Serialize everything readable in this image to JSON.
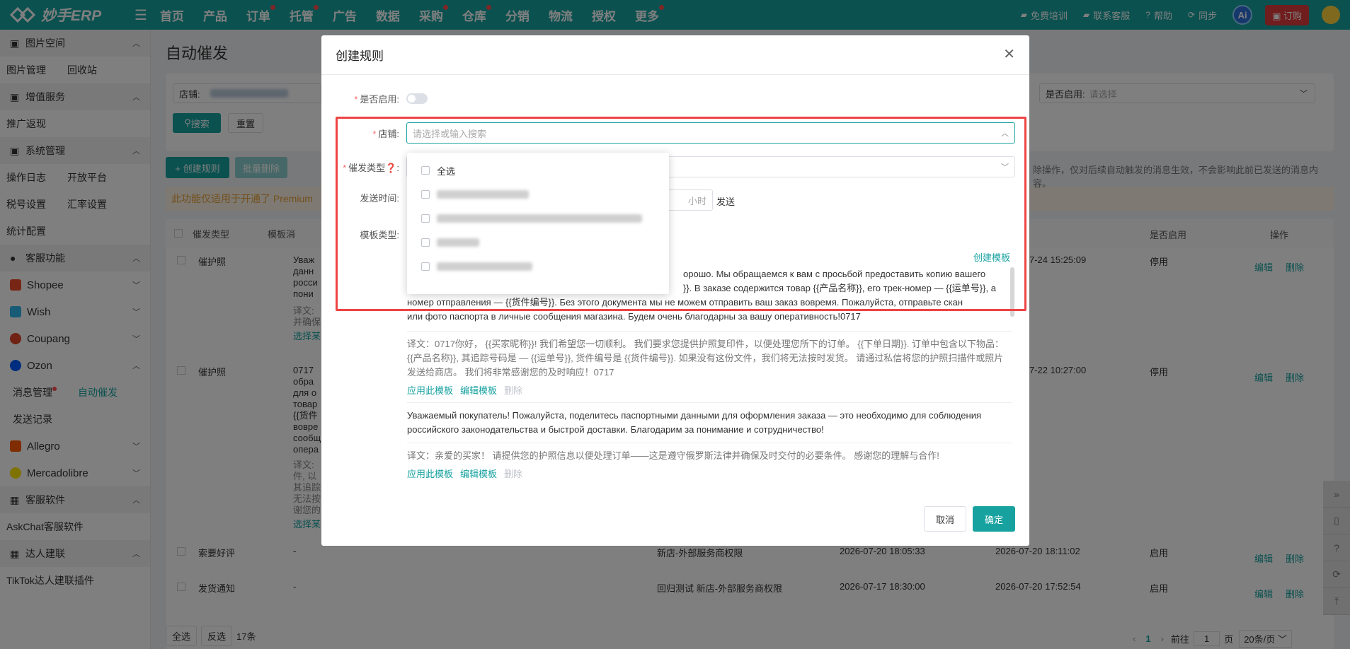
{
  "app": {
    "title": "妙手ERP"
  },
  "nav": {
    "items": [
      "首页",
      "产品",
      "订单",
      "托管",
      "广告",
      "数据",
      "采购",
      "仓库",
      "分销",
      "物流",
      "授权",
      "更多"
    ]
  },
  "top_right": {
    "training": "免费培训",
    "support": "联系客服",
    "help": "帮助",
    "sync": "同步",
    "ai": "Ai",
    "order": "订购"
  },
  "sidebar": {
    "g1": "图片空间",
    "g1_items": [
      "图片管理",
      "回收站"
    ],
    "g2": "增值服务",
    "g2_items": [
      "推广返现"
    ],
    "g3": "系统管理",
    "g3_items": [
      "操作日志",
      "开放平台",
      "税号设置",
      "汇率设置",
      "统计配置"
    ],
    "g4": "客服功能",
    "platforms": [
      "Shopee",
      "Wish",
      "Coupang",
      "Ozon"
    ],
    "ozon_sub": [
      "消息管理",
      "自动催发",
      "发送记录"
    ],
    "platforms2": [
      "Allegro",
      "Mercadolibre"
    ],
    "g5": "客服软件",
    "g5_items": [
      "AskChat客服软件"
    ],
    "g6": "达人建联",
    "g6_items": [
      "TikTok达人建联插件"
    ]
  },
  "page": {
    "title": "自动催发",
    "store_label": "店铺:",
    "enabled_label": "是否启用:",
    "enabled_placeholder": "请选择",
    "search": "搜索",
    "reset": "重置",
    "create": "+ 创建规则",
    "batch_delete": "批量删除",
    "notice": "此功能仅适用于开通了 Premium",
    "right_notice": "除操作，仅对后续自动触发的消息生效，不会影响此前已发送的消息内容。",
    "col_type": "催发类型",
    "col_tpl": "模板消",
    "col_enabled": "是否启用",
    "col_ops": "操作"
  },
  "rows": [
    {
      "type": "催护照",
      "time": "7-24 15:25:09",
      "enabled": "停用",
      "edit": "编辑",
      "del": "删除"
    },
    {
      "type": "催护照",
      "time": "7-22 10:27:00",
      "enabled": "停用",
      "edit": "编辑",
      "del": "删除"
    },
    {
      "type": "索要好评",
      "tpl": "-",
      "shop": "新店-外部服务商权限",
      "created": "2026-07-20 18:05:33",
      "time": "2026-07-20 18:11:02",
      "enabled": "启用",
      "edit": "编辑",
      "del": "删除"
    },
    {
      "type": "发货通知",
      "tpl": "-",
      "shop": "回归测试 新店-外部服务商权限",
      "created": "2026-07-17 18:30:00",
      "time": "2026-07-20 17:52:54",
      "enabled": "启用",
      "edit": "编辑",
      "del": "删除"
    }
  ],
  "pager": {
    "select_all": "全选",
    "invert": "反选",
    "total": "17条",
    "page": "1",
    "goto": "前往",
    "page_input": "1",
    "page_unit": "页",
    "page_size": "20条/页"
  },
  "modal": {
    "title": "创建规则",
    "enabled_label": "是否启用:",
    "store_label": "店铺:",
    "store_placeholder": "请选择或输入搜索",
    "type_label": "催发类型",
    "send_time_label": "发送时间:",
    "hours": "小时",
    "send": "发送",
    "tpl_type_label": "模板类型:",
    "create_template": "创建模板",
    "dropdown_all": "全选",
    "templates": [
      {
        "text_a": "орошо. Мы обращаемся к вам с просьбой предоставить копию вашего",
        "text_b": "}}. В заказе содержится товар {{产品名称}}, его трек-номер — {{运单号}}, а",
        "text_c": "номер отправления — {{货件编号}}. Без этого документа мы не можем отправить ваш заказ вовремя. Пожалуйста, отправьте скан",
        "text_d": "или фото паспорта в личные сообщения магазина. Будем очень благодарны за вашу оперативность!0717",
        "translation": "译文：0717你好， {{买家昵称}}! 我们希望您一切顺利。 我们要求您提供护照复印件，以便处理您所下的订单。 {{下单日期}}. 订单中包含以下物品：{{产品名称}}, 其追踪号码是 — {{运单号}}, 货件编号是 {{货件编号}}. 如果没有这份文件，我们将无法按时发货。 请通过私信将您的护照扫描件或照片发送给商店。 我们将非常感谢您的及时响应！0717",
        "apply": "应用此模板",
        "edit": "编辑模板",
        "delete": "删除"
      },
      {
        "text": "Уважаемый покупатель! Пожалуйста, поделитесь паспортными данными для оформления заказа — это необходимо для соблюдения российского законодательства и быстрой доставки. Благодарим за понимание и сотрудничество!",
        "translation": "译文：亲爱的买家！ 请提供您的护照信息以便处理订单——这是遵守俄罗斯法律并确保及时交付的必要条件。 感谢您的理解与合作!",
        "apply": "应用此模板",
        "edit": "编辑模板",
        "delete": "删除"
      }
    ],
    "cancel": "取消",
    "confirm": "确定"
  },
  "bg_snippets": {
    "r1": [
      "Уваж",
      "данн",
      "росси",
      "пони"
    ],
    "r1_tr": [
      "译文:",
      "并确保"
    ],
    "r1_link": "选择某",
    "r2": [
      "0717",
      "обра",
      "для о",
      "товар",
      "{{货件",
      "вовре",
      "сообщ",
      "опера"
    ],
    "r2_tr": [
      "译文:",
      "件, 以",
      "其追踪",
      "无法按",
      "谢您的"
    ],
    "r2_link": "选择某"
  },
  "colors": {
    "brand": "#17a2a0",
    "highlight": "#e44444",
    "danger": "#e03a3a"
  }
}
